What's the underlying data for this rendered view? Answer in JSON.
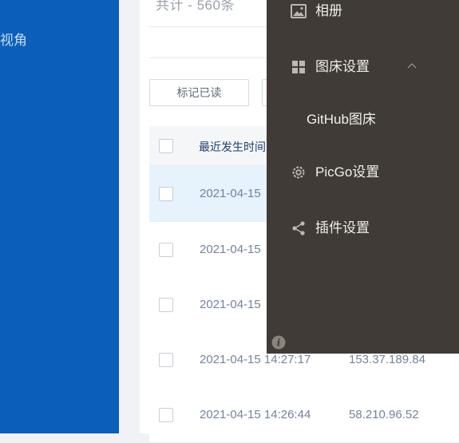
{
  "sidebar": {
    "partial_label": "视角"
  },
  "main": {
    "total": "共计 - 560条",
    "buttons": {
      "mark_read": "标记已读"
    },
    "table": {
      "header": {
        "time": "最近发生时间"
      },
      "rows": [
        {
          "time": "2021-04-15",
          "ip": ""
        },
        {
          "time": "2021-04-15",
          "ip": ""
        },
        {
          "time": "2021-04-15",
          "ip": ""
        },
        {
          "time": "2021-04-15 14:27:17",
          "ip": "153.37.189.84"
        },
        {
          "time": "2021-04-15 14:26:44",
          "ip": "58.210.96.52"
        }
      ]
    }
  },
  "menu": {
    "items": [
      {
        "label": "相册",
        "icon": "image-icon"
      },
      {
        "label": "图床设置",
        "icon": "grid-icon"
      },
      {
        "label": "GitHub图床"
      },
      {
        "label": "PicGo设置",
        "icon": "gear-icon"
      },
      {
        "label": "插件设置",
        "icon": "share-icon"
      }
    ]
  },
  "colors": {
    "sidebar_blue": "#0b5fba",
    "overlay_bg": "#403b36",
    "highlight_row": "#e6f2fc"
  }
}
